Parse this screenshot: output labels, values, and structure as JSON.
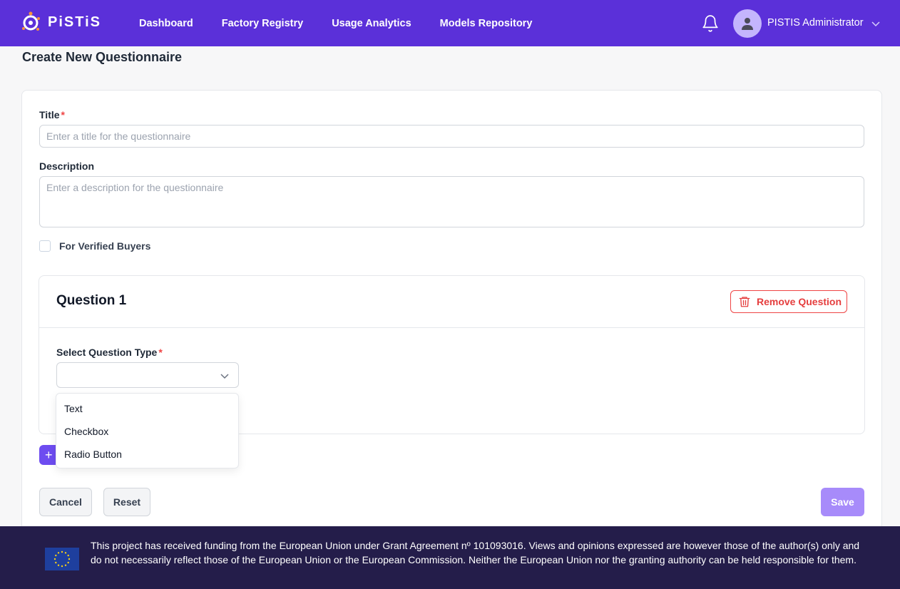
{
  "brand": {
    "name": "PISTIS",
    "logo_text": "PiSTiS"
  },
  "nav": {
    "items": [
      {
        "label": "Dashboard"
      },
      {
        "label": "Factory Registry"
      },
      {
        "label": "Usage Analytics"
      },
      {
        "label": "Models Repository"
      }
    ]
  },
  "user": {
    "name": "PISTIS Administrator"
  },
  "page": {
    "title": "Create New Questionnaire"
  },
  "form": {
    "title_label": "Title",
    "title_placeholder": "Enter a title for the questionnaire",
    "title_value": "",
    "description_label": "Description",
    "description_placeholder": "Enter a description for the questionnaire",
    "description_value": "",
    "verified_label": "For Verified Buyers",
    "verified_checked": false,
    "required_marker": "*"
  },
  "question": {
    "title": "Question 1",
    "remove_label": "Remove Question",
    "type_label": "Select Question Type",
    "type_value": "",
    "type_options": [
      "Text",
      "Checkbox",
      "Radio Button"
    ]
  },
  "actions": {
    "cancel_label": "Cancel",
    "reset_label": "Reset",
    "save_label": "Save"
  },
  "footer": {
    "text": "This project has received funding from the European Union under Grant Agreement nº 101093016. Views and opinions expressed are however those of the author(s) only and do not necessarily reflect those of the European Union or the European Commission. Neither the European Union nor the granting authority can be held responsible for them."
  },
  "colors": {
    "brand_primary": "#5b30d9",
    "danger": "#ef4444",
    "save_disabled": "#a78bfa",
    "footer_bg": "#241d4a"
  }
}
